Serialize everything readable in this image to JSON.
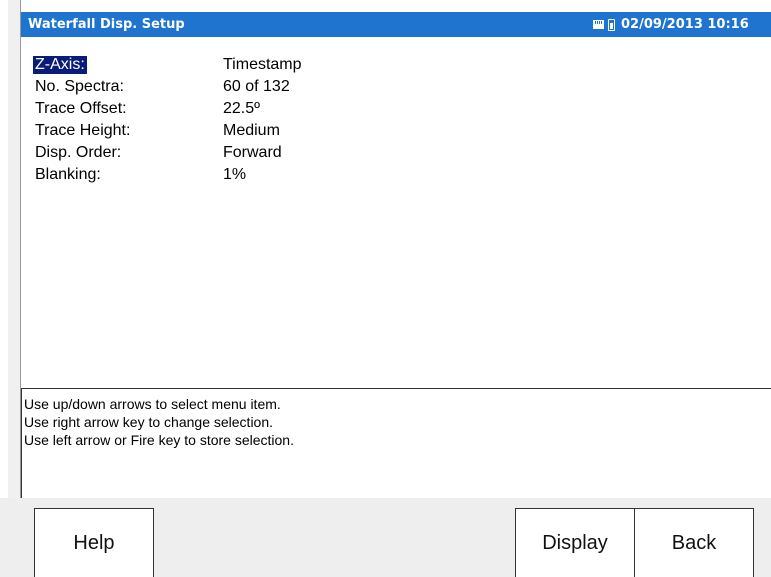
{
  "titlebar": {
    "title": "Waterfall Disp. Setup",
    "datetime": "02/09/2013 10:16",
    "icons": [
      "sd-card-icon",
      "battery-icon"
    ],
    "colors": {
      "bar": "#1e74cf",
      "text": "#ffffff"
    }
  },
  "menu": {
    "selected_index": 0,
    "items": [
      {
        "label": "Z-Axis:",
        "value": "Timestamp"
      },
      {
        "label": "No. Spectra:",
        "value": "60 of 132"
      },
      {
        "label": "Trace Offset:",
        "value": "22.5º"
      },
      {
        "label": "Trace Height:",
        "value": "Medium"
      },
      {
        "label": "Disp. Order:",
        "value": "Forward"
      },
      {
        "label": "Blanking:",
        "value": "1%"
      }
    ],
    "colors": {
      "selection_bg": "#0a1c7a",
      "selection_text": "#ffffff"
    }
  },
  "help": {
    "lines": [
      "Use up/down arrows to select menu item.",
      "Use right arrow key to change selection.",
      "Use left arrow or Fire key to store selection."
    ]
  },
  "softkeys": {
    "help": "Help",
    "display": "Display",
    "back": "Back"
  }
}
